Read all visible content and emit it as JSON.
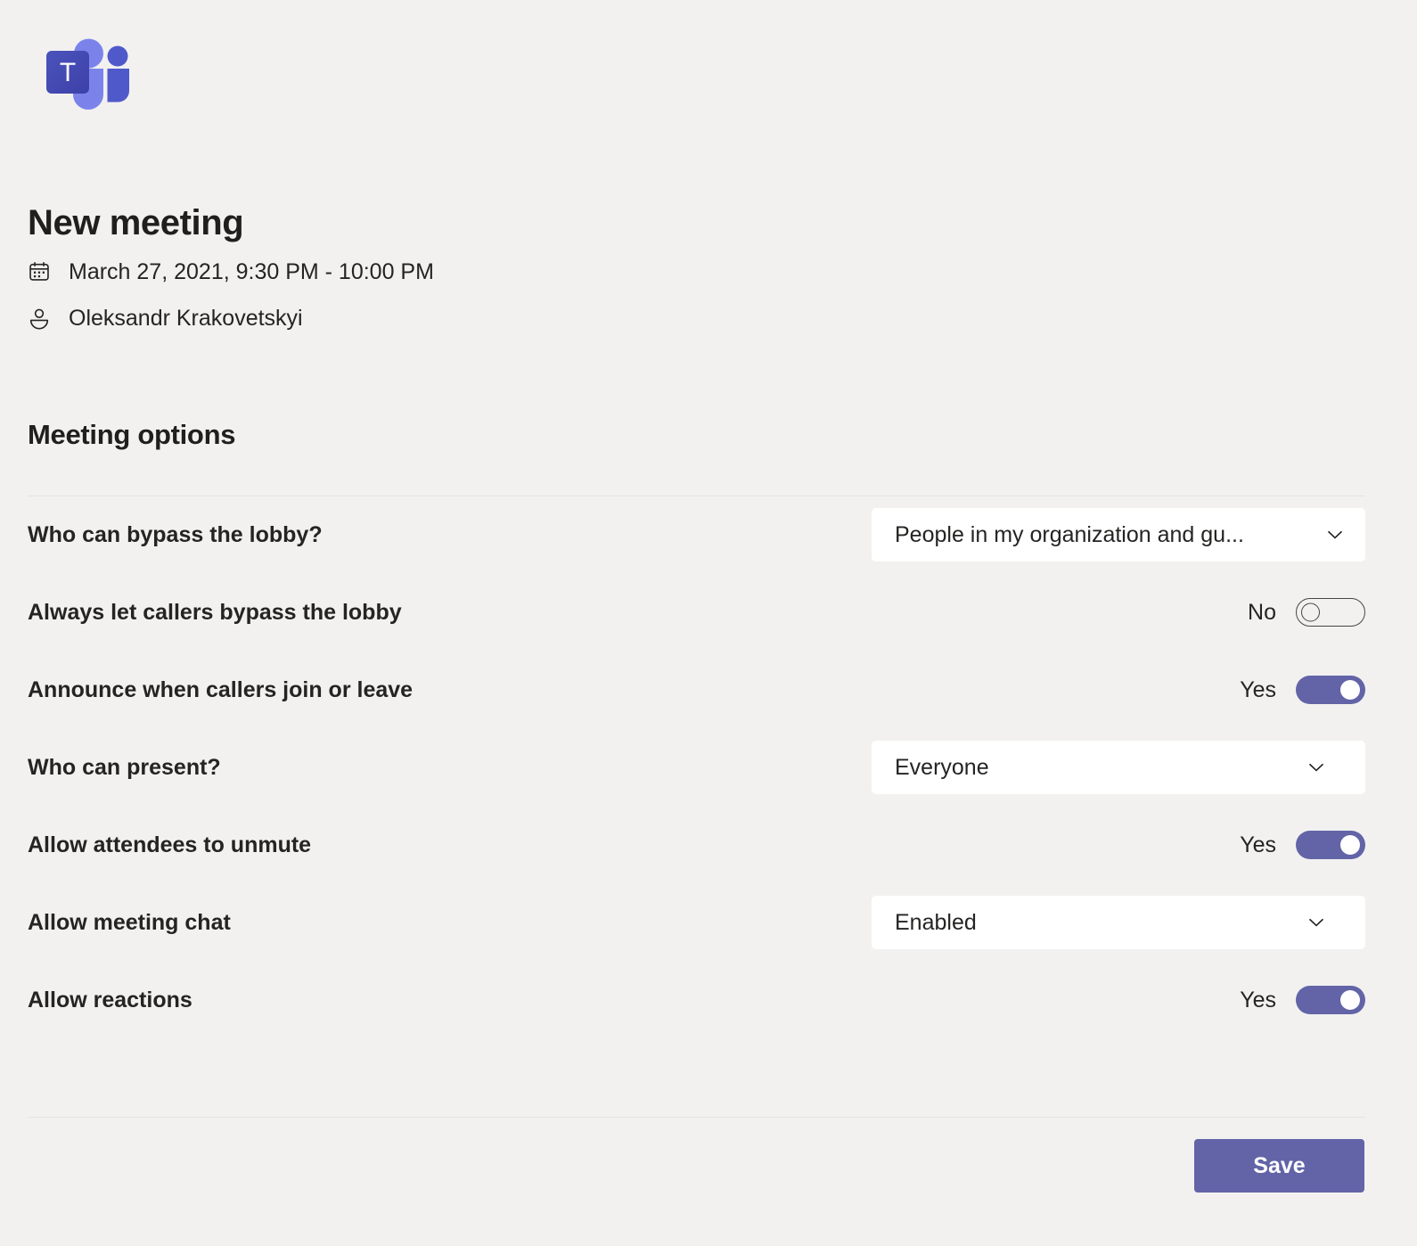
{
  "app": {
    "logo_name": "microsoft-teams-logo",
    "brand_color": "#6264a7",
    "page_background": "#f2f1f0",
    "surface_color": "#ffffff"
  },
  "header": {
    "title": "New meeting",
    "date_icon": "calendar-icon",
    "date_text": "March 27, 2021, 9:30 PM - 10:00 PM",
    "organizer_icon": "person-icon",
    "organizer_text": "Oleksandr Krakovetskyi"
  },
  "section": {
    "heading": "Meeting options"
  },
  "options": [
    {
      "label": "Who can bypass the lobby?",
      "control": "dropdown",
      "name": "who-can-bypass-the-lobby",
      "value": "People in my organization and gu...",
      "chev_style": "wide-chev"
    },
    {
      "label": "Always let callers bypass the lobby",
      "control": "toggle",
      "name": "always-let-callers-bypass-the-lobby",
      "value": "No",
      "state": "off"
    },
    {
      "label": "Announce when callers join or leave",
      "control": "toggle",
      "name": "announce-when-callers-join-or-leave",
      "value": "Yes",
      "state": "on"
    },
    {
      "label": "Who can present?",
      "control": "dropdown",
      "name": "who-can-present",
      "value": "Everyone",
      "chev_style": "narrow-chev"
    },
    {
      "label": "Allow attendees to unmute",
      "control": "toggle",
      "name": "allow-attendees-to-unmute",
      "value": "Yes",
      "state": "on"
    },
    {
      "label": "Allow meeting chat",
      "control": "dropdown",
      "name": "allow-meeting-chat",
      "value": "Enabled",
      "chev_style": "narrow-chev"
    },
    {
      "label": "Allow reactions",
      "control": "toggle",
      "name": "allow-reactions",
      "value": "Yes",
      "state": "on"
    }
  ],
  "footer": {
    "save_label": "Save"
  }
}
